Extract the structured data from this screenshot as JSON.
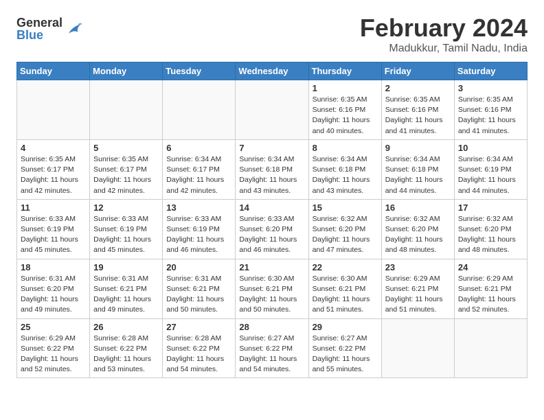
{
  "logo": {
    "general": "General",
    "blue": "Blue"
  },
  "header": {
    "title": "February 2024",
    "subtitle": "Madukkur, Tamil Nadu, India"
  },
  "weekdays": [
    "Sunday",
    "Monday",
    "Tuesday",
    "Wednesday",
    "Thursday",
    "Friday",
    "Saturday"
  ],
  "weeks": [
    [
      {
        "day": "",
        "info": ""
      },
      {
        "day": "",
        "info": ""
      },
      {
        "day": "",
        "info": ""
      },
      {
        "day": "",
        "info": ""
      },
      {
        "day": "1",
        "info": "Sunrise: 6:35 AM\nSunset: 6:16 PM\nDaylight: 11 hours\nand 40 minutes."
      },
      {
        "day": "2",
        "info": "Sunrise: 6:35 AM\nSunset: 6:16 PM\nDaylight: 11 hours\nand 41 minutes."
      },
      {
        "day": "3",
        "info": "Sunrise: 6:35 AM\nSunset: 6:16 PM\nDaylight: 11 hours\nand 41 minutes."
      }
    ],
    [
      {
        "day": "4",
        "info": "Sunrise: 6:35 AM\nSunset: 6:17 PM\nDaylight: 11 hours\nand 42 minutes."
      },
      {
        "day": "5",
        "info": "Sunrise: 6:35 AM\nSunset: 6:17 PM\nDaylight: 11 hours\nand 42 minutes."
      },
      {
        "day": "6",
        "info": "Sunrise: 6:34 AM\nSunset: 6:17 PM\nDaylight: 11 hours\nand 42 minutes."
      },
      {
        "day": "7",
        "info": "Sunrise: 6:34 AM\nSunset: 6:18 PM\nDaylight: 11 hours\nand 43 minutes."
      },
      {
        "day": "8",
        "info": "Sunrise: 6:34 AM\nSunset: 6:18 PM\nDaylight: 11 hours\nand 43 minutes."
      },
      {
        "day": "9",
        "info": "Sunrise: 6:34 AM\nSunset: 6:18 PM\nDaylight: 11 hours\nand 44 minutes."
      },
      {
        "day": "10",
        "info": "Sunrise: 6:34 AM\nSunset: 6:19 PM\nDaylight: 11 hours\nand 44 minutes."
      }
    ],
    [
      {
        "day": "11",
        "info": "Sunrise: 6:33 AM\nSunset: 6:19 PM\nDaylight: 11 hours\nand 45 minutes."
      },
      {
        "day": "12",
        "info": "Sunrise: 6:33 AM\nSunset: 6:19 PM\nDaylight: 11 hours\nand 45 minutes."
      },
      {
        "day": "13",
        "info": "Sunrise: 6:33 AM\nSunset: 6:19 PM\nDaylight: 11 hours\nand 46 minutes."
      },
      {
        "day": "14",
        "info": "Sunrise: 6:33 AM\nSunset: 6:20 PM\nDaylight: 11 hours\nand 46 minutes."
      },
      {
        "day": "15",
        "info": "Sunrise: 6:32 AM\nSunset: 6:20 PM\nDaylight: 11 hours\nand 47 minutes."
      },
      {
        "day": "16",
        "info": "Sunrise: 6:32 AM\nSunset: 6:20 PM\nDaylight: 11 hours\nand 48 minutes."
      },
      {
        "day": "17",
        "info": "Sunrise: 6:32 AM\nSunset: 6:20 PM\nDaylight: 11 hours\nand 48 minutes."
      }
    ],
    [
      {
        "day": "18",
        "info": "Sunrise: 6:31 AM\nSunset: 6:20 PM\nDaylight: 11 hours\nand 49 minutes."
      },
      {
        "day": "19",
        "info": "Sunrise: 6:31 AM\nSunset: 6:21 PM\nDaylight: 11 hours\nand 49 minutes."
      },
      {
        "day": "20",
        "info": "Sunrise: 6:31 AM\nSunset: 6:21 PM\nDaylight: 11 hours\nand 50 minutes."
      },
      {
        "day": "21",
        "info": "Sunrise: 6:30 AM\nSunset: 6:21 PM\nDaylight: 11 hours\nand 50 minutes."
      },
      {
        "day": "22",
        "info": "Sunrise: 6:30 AM\nSunset: 6:21 PM\nDaylight: 11 hours\nand 51 minutes."
      },
      {
        "day": "23",
        "info": "Sunrise: 6:29 AM\nSunset: 6:21 PM\nDaylight: 11 hours\nand 51 minutes."
      },
      {
        "day": "24",
        "info": "Sunrise: 6:29 AM\nSunset: 6:21 PM\nDaylight: 11 hours\nand 52 minutes."
      }
    ],
    [
      {
        "day": "25",
        "info": "Sunrise: 6:29 AM\nSunset: 6:22 PM\nDaylight: 11 hours\nand 52 minutes."
      },
      {
        "day": "26",
        "info": "Sunrise: 6:28 AM\nSunset: 6:22 PM\nDaylight: 11 hours\nand 53 minutes."
      },
      {
        "day": "27",
        "info": "Sunrise: 6:28 AM\nSunset: 6:22 PM\nDaylight: 11 hours\nand 54 minutes."
      },
      {
        "day": "28",
        "info": "Sunrise: 6:27 AM\nSunset: 6:22 PM\nDaylight: 11 hours\nand 54 minutes."
      },
      {
        "day": "29",
        "info": "Sunrise: 6:27 AM\nSunset: 6:22 PM\nDaylight: 11 hours\nand 55 minutes."
      },
      {
        "day": "",
        "info": ""
      },
      {
        "day": "",
        "info": ""
      }
    ]
  ]
}
